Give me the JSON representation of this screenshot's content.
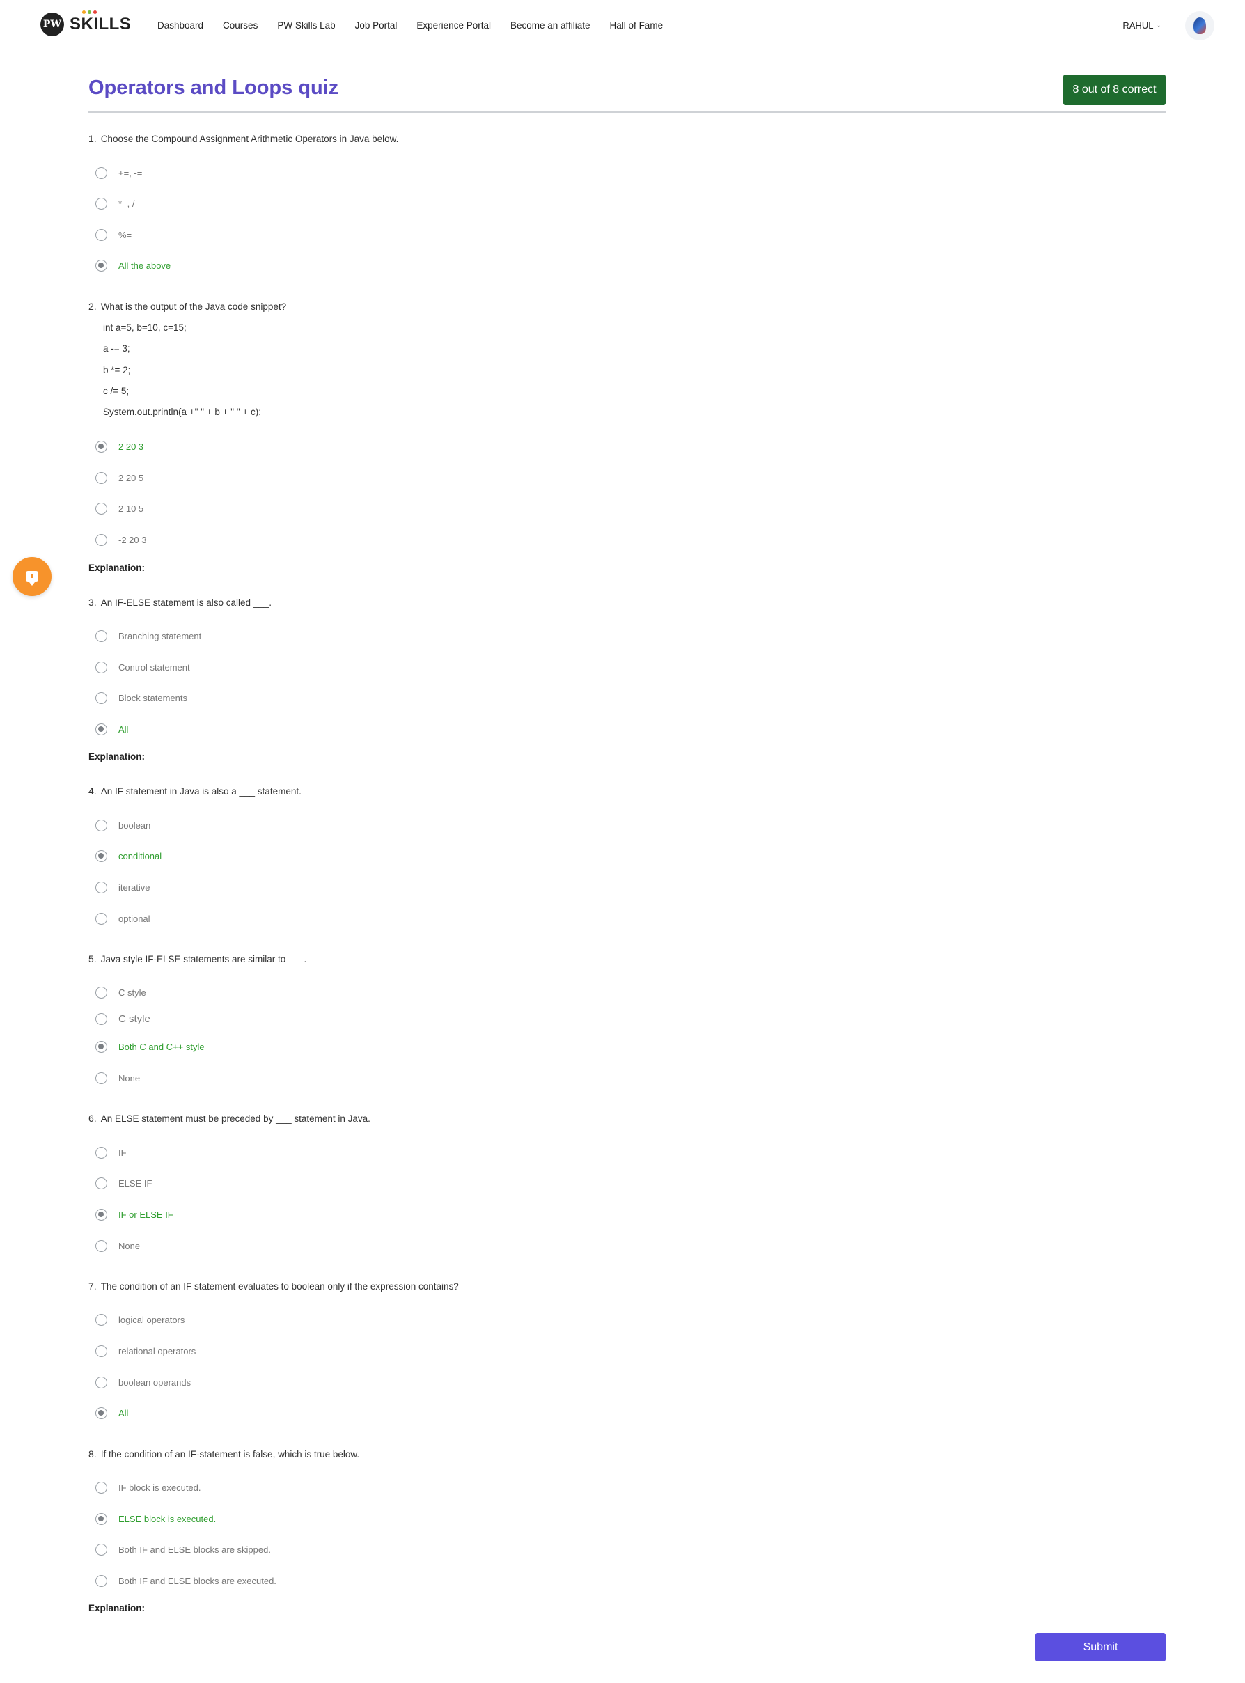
{
  "header": {
    "logo_text": "SKILLS",
    "logo_mark": "PW",
    "nav": [
      "Dashboard",
      "Courses",
      "PW Skills Lab",
      "Job Portal",
      "Experience Portal",
      "Become an affiliate",
      "Hall of Fame"
    ],
    "user_name": "RAHUL"
  },
  "quiz": {
    "title": "Operators and Loops quiz",
    "score": "8 out of 8 correct",
    "explanation_label": "Explanation:",
    "submit_label": "Submit",
    "questions": [
      {
        "number": "1.",
        "text": "Choose the Compound Assignment Arithmetic Operators in Java below.",
        "options": [
          {
            "label": "+=, -=",
            "selected": false
          },
          {
            "label": "*=, /=",
            "selected": false
          },
          {
            "label": "%=",
            "selected": false
          },
          {
            "label": "All the above",
            "selected": true
          }
        ]
      },
      {
        "number": "2.",
        "text": "What is the output of the Java code snippet?",
        "code": [
          "int a=5, b=10, c=15;",
          "a -= 3;",
          "b *= 2;",
          "c /= 5;",
          "System.out.println(a +\" \" + b + \" \" + c);"
        ],
        "options": [
          {
            "label": "2 20 3",
            "selected": true
          },
          {
            "label": "2 20 5",
            "selected": false
          },
          {
            "label": "2 10 5",
            "selected": false
          },
          {
            "label": "-2 20 3",
            "selected": false
          }
        ]
      },
      {
        "number": "3.",
        "text": "An IF-ELSE statement is also called ___.",
        "options": [
          {
            "label": "Branching statement",
            "selected": false
          },
          {
            "label": "Control statement",
            "selected": false
          },
          {
            "label": "Block statements",
            "selected": false
          },
          {
            "label": "All",
            "selected": true
          }
        ]
      },
      {
        "number": "4.",
        "text": "An IF statement in Java is also a ___ statement.",
        "options": [
          {
            "label": "boolean",
            "selected": false
          },
          {
            "label": "conditional",
            "selected": true
          },
          {
            "label": "iterative",
            "selected": false
          },
          {
            "label": "optional",
            "selected": false
          }
        ]
      },
      {
        "number": "5.",
        "text": "Java style IF-ELSE statements are similar to ___.",
        "options": [
          {
            "label": "C style",
            "selected": false
          },
          {
            "label": "C style",
            "selected": false
          },
          {
            "label": "Both C and C++ style",
            "selected": true
          },
          {
            "label": "None",
            "selected": false
          }
        ]
      },
      {
        "number": "6.",
        "text": "An ELSE statement must be preceded by ___ statement in Java.",
        "options": [
          {
            "label": "IF",
            "selected": false
          },
          {
            "label": "ELSE IF",
            "selected": false
          },
          {
            "label": "IF or ELSE IF",
            "selected": true
          },
          {
            "label": "None",
            "selected": false
          }
        ]
      },
      {
        "number": "7.",
        "text": "The condition of an IF statement evaluates to boolean only if the expression contains?",
        "options": [
          {
            "label": "logical operators",
            "selected": false
          },
          {
            "label": "relational operators",
            "selected": false
          },
          {
            "label": "boolean operands",
            "selected": false
          },
          {
            "label": "All",
            "selected": true
          }
        ]
      },
      {
        "number": "8.",
        "text": "If the condition of an IF-statement is false, which is true below.",
        "options": [
          {
            "label": "IF block is executed.",
            "selected": false
          },
          {
            "label": "ELSE block is executed.",
            "selected": true
          },
          {
            "label": "Both IF and ELSE blocks are skipped.",
            "selected": false
          },
          {
            "label": "Both IF and ELSE blocks are executed.",
            "selected": false
          }
        ]
      }
    ]
  },
  "colors": {
    "accent": "#5b4bc4",
    "score_badge": "#1e6b2e",
    "correct": "#2f9e2f",
    "submit": "#5b4fe0",
    "fab": "#f7932b"
  }
}
